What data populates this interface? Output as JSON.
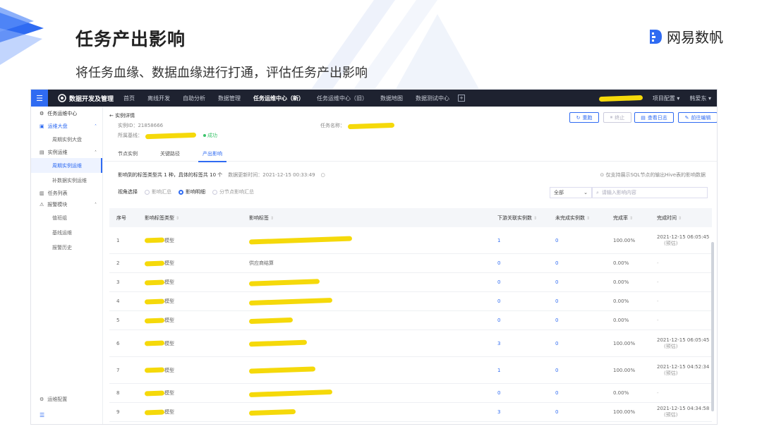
{
  "slide": {
    "title": "任务产出影响",
    "subtitle": "将任务血缘、数据血缘进行打通，评估任务产出影响",
    "brand": "网易数帆"
  },
  "topnav": {
    "app_name": "数据开发及管理",
    "items": [
      "首页",
      "离线开发",
      "自助分析",
      "数据管理",
      "任务运维中心（新）",
      "任务运维中心（旧）",
      "数据地图",
      "数据测试中心"
    ],
    "active_index": 4,
    "project_config": "项目配置 ▾",
    "user": "韩爱东 ▾"
  },
  "sidebar": {
    "head": "任务运维中心",
    "groups": [
      {
        "label": "运维大盘",
        "items": [
          "周期实例大盘"
        ]
      },
      {
        "label": "实例运维",
        "items": [
          "周期实例运维",
          "补数据实例运维"
        ]
      },
      {
        "label": "任务列表",
        "items": []
      },
      {
        "label": "报警模块",
        "items": [
          "值班组",
          "基线运维",
          "报警历史"
        ]
      }
    ],
    "active_item": "周期实例运维",
    "bottom": "运维配置"
  },
  "detail": {
    "back": "实例详情",
    "instance_id_label": "实例ID：",
    "instance_id": "21858666",
    "baseline_label": "所属基线：",
    "status": "成功",
    "task_name_label": "任务名称：",
    "buttons": [
      "重跑",
      "终止",
      "查看日志",
      "前往编辑"
    ]
  },
  "tabs": [
    "节点实例",
    "关键路径",
    "产出影响"
  ],
  "active_tab": 2,
  "summary": {
    "text": "影响到的标签类型共 1 种，具体的标签共 10 个",
    "updated": "数据更新时间：2021-12-15 00:33:49"
  },
  "note": "仅支持展示SQL节点的输出Hive表的影响数据",
  "view": {
    "label": "视角选择",
    "options": [
      "影响汇总",
      "影响明细",
      "分节点影响汇总"
    ],
    "selected": 1
  },
  "filter": {
    "select": "全部",
    "search_placeholder": "请输入影响内容"
  },
  "table": {
    "headers": [
      "序号",
      "影响标签类型",
      "影响标签",
      "下游关联实例数",
      "未完成实例数",
      "完成率",
      "完成时间"
    ],
    "rows": [
      {
        "no": "1",
        "type": "模型",
        "label": "",
        "down": "1",
        "undone": "0",
        "rate": "100.00%",
        "time": "2021-12-15 06:05:45",
        "note": "(预估)"
      },
      {
        "no": "2",
        "type": "模型",
        "label": "供应商结算",
        "down": "0",
        "undone": "0",
        "rate": "0.00%",
        "time": "-",
        "note": ""
      },
      {
        "no": "3",
        "type": "模型",
        "label": "",
        "down": "0",
        "undone": "0",
        "rate": "0.00%",
        "time": "-",
        "note": ""
      },
      {
        "no": "4",
        "type": "模型",
        "label": "",
        "down": "0",
        "undone": "0",
        "rate": "0.00%",
        "time": "-",
        "note": ""
      },
      {
        "no": "5",
        "type": "模型",
        "label": "",
        "down": "0",
        "undone": "0",
        "rate": "0.00%",
        "time": "-",
        "note": ""
      },
      {
        "no": "6",
        "type": "模型",
        "label": "",
        "down": "3",
        "undone": "0",
        "rate": "100.00%",
        "time": "2021-12-15 06:05:45",
        "note": "(预估)"
      },
      {
        "no": "7",
        "type": "模型",
        "label": "",
        "down": "1",
        "undone": "0",
        "rate": "100.00%",
        "time": "2021-12-15 04:52:34",
        "note": "(预估)"
      },
      {
        "no": "8",
        "type": "模型",
        "label": "",
        "down": "0",
        "undone": "0",
        "rate": "0.00%",
        "time": "-",
        "note": ""
      },
      {
        "no": "9",
        "type": "模型",
        "label": "",
        "down": "3",
        "undone": "0",
        "rate": "100.00%",
        "time": "2021-12-15 04:34:58",
        "note": "(预估)"
      }
    ]
  },
  "colors": {
    "accent": "#2f6bf2",
    "nav_bg": "#1e2230",
    "redaction": "#f5d90a",
    "success": "#3cc46b"
  }
}
